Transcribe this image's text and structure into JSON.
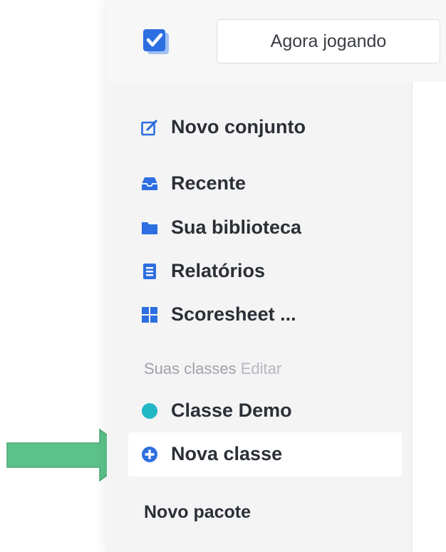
{
  "header": {
    "now_playing_label": "Agora jogando",
    "logo_icon": "check-square-stack-icon",
    "accent": "#2d6fe0"
  },
  "sidebar": {
    "new_set": {
      "label": "Novo conjunto",
      "icon": "edit-square-icon"
    },
    "nav": [
      {
        "label": "Recente",
        "icon": "inbox-tray-icon"
      },
      {
        "label": "Sua biblioteca",
        "icon": "folder-icon"
      },
      {
        "label": "Relatórios",
        "icon": "report-document-icon"
      },
      {
        "label": "Scoresheet ...",
        "icon": "grid-icon"
      }
    ],
    "classes_section": {
      "label": "Suas classes",
      "edit_label": "Editar"
    },
    "classes": [
      {
        "label": "Classe Demo",
        "icon": "teal-dot-icon",
        "color": "#22b7c4"
      }
    ],
    "new_class": {
      "label": "Nova classe",
      "icon": "plus-circle-icon"
    },
    "new_package": {
      "label": "Novo pacote"
    }
  },
  "annotation": {
    "arrow_color": "#5cc28a",
    "icon": "arrow-right-icon"
  }
}
